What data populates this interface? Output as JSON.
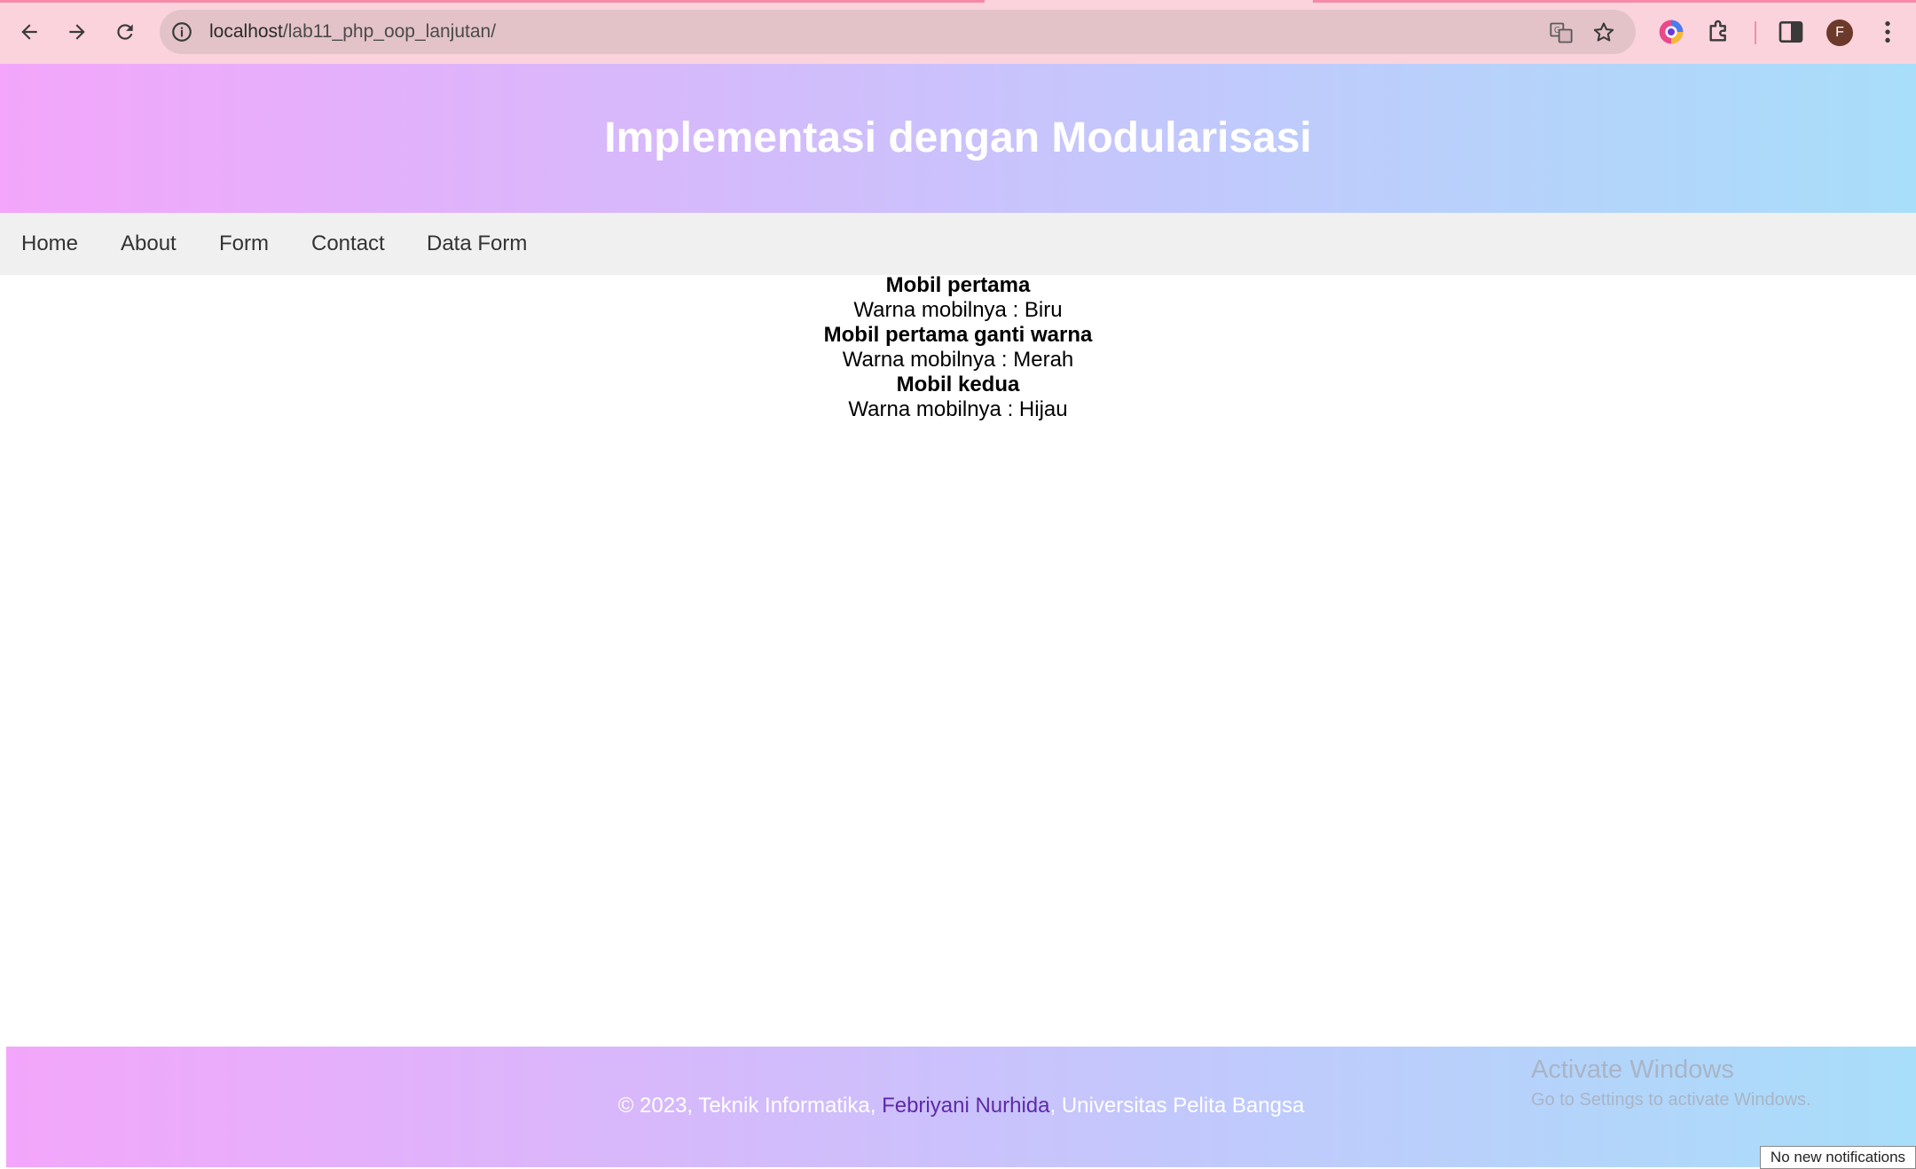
{
  "browser": {
    "url_host": "localhost",
    "url_path": "/lab11_php_oop_lanjutan/",
    "avatar_letter": "F",
    "icons": [
      "back-arrow-icon",
      "forward-arrow-icon",
      "reload-icon",
      "site-info-icon",
      "translate-icon",
      "bookmark-star-icon",
      "color-extension-icon",
      "extensions-puzzle-icon",
      "side-panel-icon",
      "profile-avatar",
      "more-menu-icon"
    ]
  },
  "header": {
    "title": "Implementasi dengan Modularisasi"
  },
  "nav": {
    "items": [
      "Home",
      "About",
      "Form",
      "Contact",
      "Data Form"
    ]
  },
  "content": {
    "lines": [
      {
        "label": "Mobil pertama",
        "value": "Warna mobilnya : Biru"
      },
      {
        "label": "Mobil pertama ganti warna",
        "value": "Warna mobilnya : Merah"
      },
      {
        "label": "Mobil kedua",
        "value": "Warna mobilnya : Hijau"
      }
    ]
  },
  "footer": {
    "prefix": "© 2023, Teknik Informatika, ",
    "author": "Febriyani Nurhida",
    "suffix": ", Universitas Pelita Bangsa"
  },
  "os_overlay": {
    "activate_title": "Activate Windows",
    "activate_subtitle": "Go to Settings to activate Windows.",
    "notification": "No new notifications"
  },
  "colors": {
    "chrome_bg": "#fbd3dc",
    "header_gradient_start": "#f3a6fb",
    "header_gradient_end": "#a8def9",
    "nav_bg": "#f0f0f0",
    "author_link": "#5e2aa8"
  }
}
